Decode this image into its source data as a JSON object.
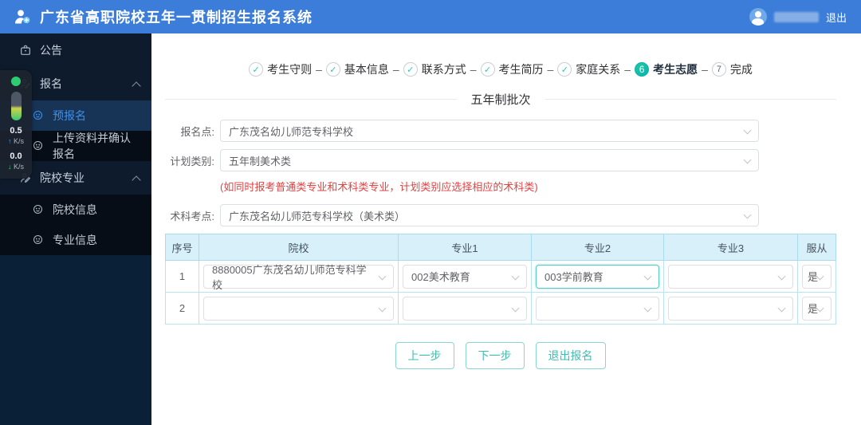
{
  "header": {
    "title": "广东省高职院校五年一贯制招生报名系统",
    "logout_label": "退出"
  },
  "sidebar": {
    "items": [
      {
        "label": "公告",
        "icon": "clipboard-icon"
      },
      {
        "label": "报名",
        "icon": "person-edit-icon",
        "expanded": true
      },
      {
        "label": "预报名",
        "icon": "face-icon",
        "active": true
      },
      {
        "label": "上传资料并确认报名",
        "icon": "face-icon"
      },
      {
        "label": "院校专业",
        "icon": "person-edit-icon",
        "expanded": true
      },
      {
        "label": "院校信息",
        "icon": "face-icon"
      },
      {
        "label": "专业信息",
        "icon": "face-icon"
      }
    ]
  },
  "overlay": {
    "up_speed": "0.5",
    "up_unit": "K/s",
    "down_speed": "0.0",
    "down_unit": "K/s"
  },
  "icons": {
    "check": "✓",
    "up_arrow": "↑",
    "down_arrow": "↓"
  },
  "steps": {
    "separator": "–",
    "items": [
      {
        "label": "考生守则",
        "state": "done"
      },
      {
        "label": "基本信息",
        "state": "done"
      },
      {
        "label": "联系方式",
        "state": "done"
      },
      {
        "label": "考生简历",
        "state": "done"
      },
      {
        "label": "家庭关系",
        "state": "done"
      },
      {
        "label": "考生志愿",
        "state": "current",
        "number": "6"
      },
      {
        "label": "完成",
        "state": "todo",
        "number": "7"
      }
    ]
  },
  "form": {
    "section_title": "五年制批次",
    "fields": [
      {
        "label": "报名点:",
        "value": "广东茂名幼儿师范专科学校"
      },
      {
        "label": "计划类别:",
        "value": "五年制美术类",
        "note": "(如同时报考普通类专业和术科类专业，计划类别应选择相应的术科类)"
      },
      {
        "label": "术科考点:",
        "value": "广东茂名幼儿师范专科学校（美术类）"
      }
    ]
  },
  "table": {
    "headers": [
      "序号",
      "院校",
      "专业1",
      "专业2",
      "专业3",
      "服从"
    ],
    "rows": [
      {
        "index": "1",
        "college": "8880005广东茂名幼儿师范专科学校",
        "major1": "002美术教育",
        "major2": "003学前教育",
        "major3": "",
        "obey": "是"
      },
      {
        "index": "2",
        "college": "",
        "major1": "",
        "major2": "",
        "major3": "",
        "obey": "是"
      }
    ]
  },
  "buttons": {
    "prev": "上一步",
    "next": "下一步",
    "exit": "退出报名"
  },
  "colors": {
    "header_bg": "#3b7dd8",
    "accent_teal": "#14c0ae",
    "active_blue": "#3f8fe8",
    "table_header_bg": "#d7f0fa",
    "error_red": "#e04343"
  }
}
